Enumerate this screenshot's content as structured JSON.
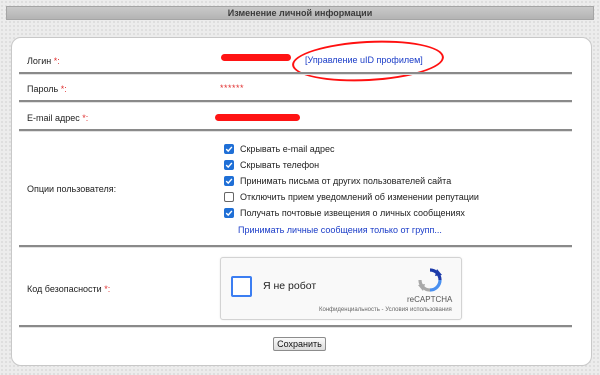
{
  "page": {
    "title": "Изменение личной информации",
    "accent_color": "#1f6fd6",
    "required_mark": "*:",
    "required_color": "#e03030"
  },
  "login": {
    "label": "Логин",
    "manage_link": "[Управление uID профилем]"
  },
  "password": {
    "label": "Пароль",
    "masked_value": "******"
  },
  "email": {
    "label": "E-mail адрес"
  },
  "options": {
    "label": "Опции пользователя:",
    "items": [
      {
        "label": "Скрывать e-mail адрес",
        "checked": true
      },
      {
        "label": "Скрывать телефон",
        "checked": true
      },
      {
        "label": "Принимать письма от других пользователей сайта",
        "checked": true
      },
      {
        "label": "Отключить прием уведомлений об изменении репутации",
        "checked": false
      },
      {
        "label": "Получать почтовые извещения о личных сообщениях",
        "checked": true
      }
    ],
    "group_link": "Принимать личные сообщения только от групп..."
  },
  "security": {
    "label": "Код безопасности",
    "captcha_text": "Я не робот",
    "captcha_brand": "reCAPTCHA",
    "captcha_terms": "Конфиденциальность - Условия использования",
    "captcha_icon": "recaptcha-logo-icon",
    "checked": false
  },
  "actions": {
    "save_label": "Сохранить"
  }
}
